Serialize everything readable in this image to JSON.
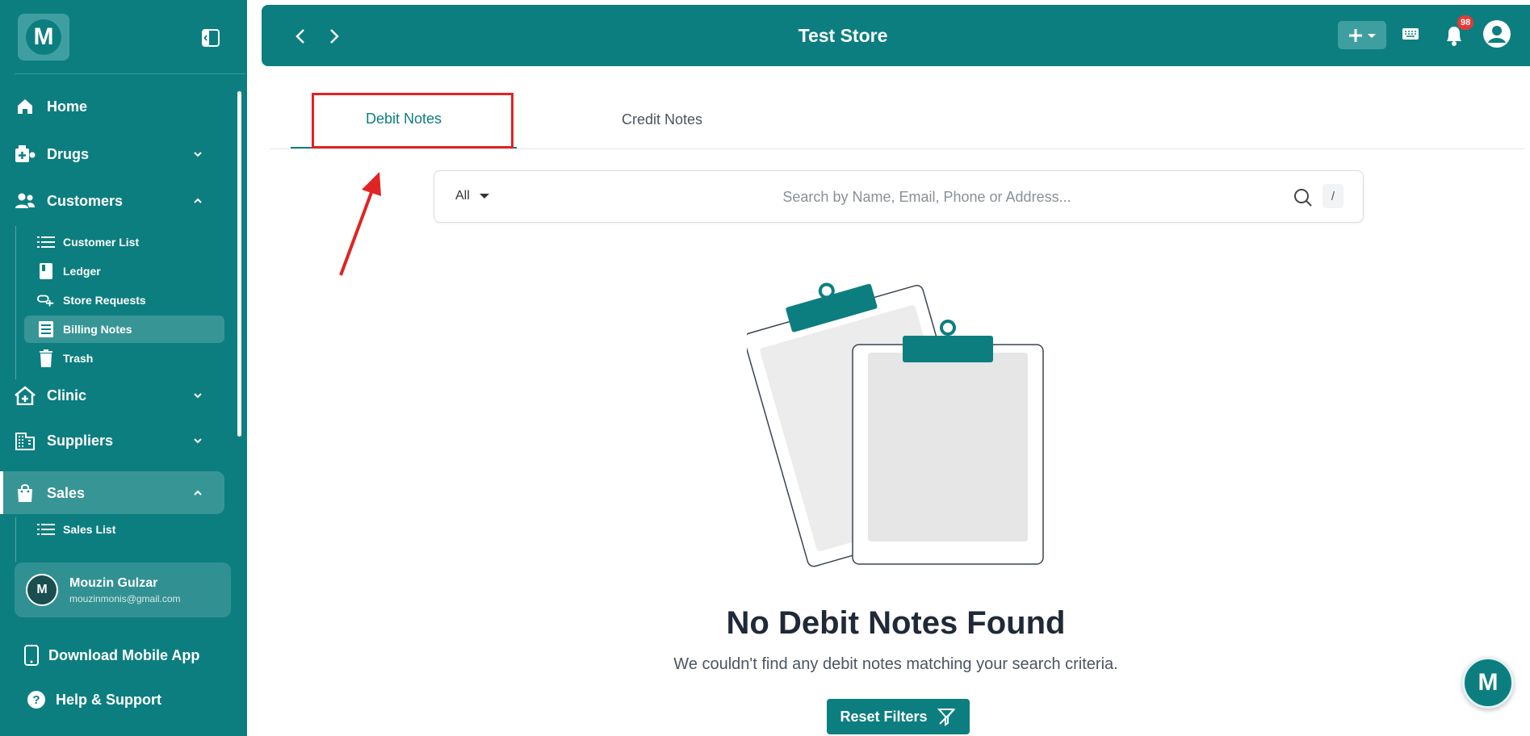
{
  "app": {
    "logo_letter": "M",
    "store_title": "Test Store",
    "notification_count": "98"
  },
  "sidebar": {
    "items": [
      {
        "label": "Home"
      },
      {
        "label": "Drugs"
      },
      {
        "label": "Customers"
      },
      {
        "label": "Clinic"
      },
      {
        "label": "Suppliers"
      },
      {
        "label": "Sales"
      }
    ],
    "customers_sub": [
      {
        "label": "Customer List"
      },
      {
        "label": "Ledger"
      },
      {
        "label": "Store Requests"
      },
      {
        "label": "Billing Notes"
      },
      {
        "label": "Trash"
      }
    ],
    "sales_sub": [
      {
        "label": "Sales List"
      }
    ],
    "user": {
      "initial": "M",
      "name": "Mouzin Gulzar",
      "email": "mouzinmonis@gmail.com"
    },
    "download_app": "Download Mobile App",
    "help": "Help & Support"
  },
  "tabs": {
    "debit": "Debit Notes",
    "credit": "Credit Notes"
  },
  "search": {
    "filter_value": "All",
    "placeholder": "Search by Name, Email, Phone or Address...",
    "shortcut": "/"
  },
  "empty_state": {
    "title": "No Debit Notes Found",
    "subtitle": "We couldn't find any debit notes matching your search criteria.",
    "reset_label": "Reset Filters"
  },
  "colors": {
    "primary": "#0d7e7f",
    "highlight": "#e02424"
  },
  "chat": {
    "letter": "M"
  }
}
